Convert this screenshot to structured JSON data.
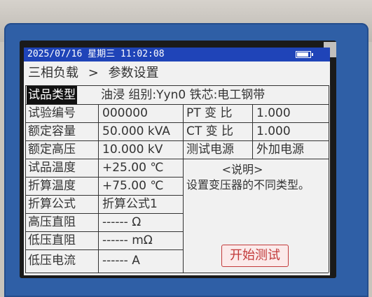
{
  "status": {
    "datetime": "2025/07/16  星期三  11:02:08",
    "battery_level": 0.9
  },
  "breadcrumb": {
    "section": "三相负载",
    "sep": ">",
    "page": "参数设置"
  },
  "rows": [
    {
      "label": "试品类型",
      "value": "油浸 组别:Yyn0  铁芯:电工钢带",
      "selected": true
    },
    {
      "label": "试验编号",
      "value": "000000"
    },
    {
      "label": "额定容量",
      "value": "50.000 kVA"
    },
    {
      "label": "额定高压",
      "value": "10.000 kV"
    },
    {
      "label": "试品温度",
      "value": "+25.00 ℃"
    },
    {
      "label": "折算温度",
      "value": "+75.00 ℃"
    },
    {
      "label": "折算公式",
      "value": "折算公式1"
    },
    {
      "label": "高压直阻",
      "value": "------ Ω"
    },
    {
      "label": "低压直阻",
      "value": "------ mΩ"
    },
    {
      "label": "低压电流",
      "value": "------ A"
    }
  ],
  "right_rows": [
    {
      "label": "PT 变 比",
      "value": "1.000"
    },
    {
      "label": "CT 变 比",
      "value": "1.000"
    },
    {
      "label": "测试电源",
      "value": "外加电源"
    }
  ],
  "explain": {
    "title": "<说明>",
    "text": "设置变压器的不同类型。"
  },
  "start_button": "开始测试",
  "colors": {
    "statusbar": "#1f44b8",
    "bezel": "#2f5fa6",
    "button": "#c23a3a",
    "screen": "#f1f1f1"
  }
}
